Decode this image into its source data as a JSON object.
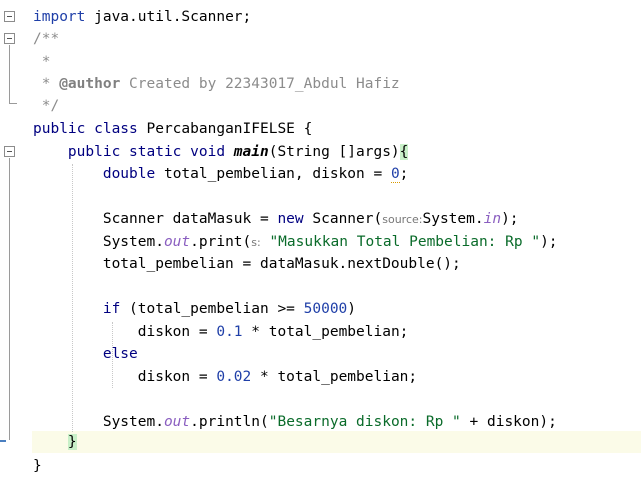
{
  "editor": {
    "lines": {
      "l1": {
        "kw": "import",
        "rest": " java.util.Scanner;"
      },
      "l2": {
        "text": "/**"
      },
      "l3": {
        "text": " *"
      },
      "l4": {
        "prefix": " * ",
        "tag": "@author",
        "rest": " Created by 22343017_Abdul Hafiz"
      },
      "l5": {
        "text": " */"
      },
      "l6": {
        "kw": "public class",
        "rest": " PercabanganIFELSE {"
      },
      "l7": {
        "indent": "    ",
        "kw": "public static void",
        "space": " ",
        "method": "main",
        "rest": "(String []args)",
        "brace": "{"
      },
      "l8": {
        "indent": "        ",
        "kw": "double",
        "rest": " total_pembelian, diskon = ",
        "num": "0",
        "end": ";"
      },
      "l9": {
        "indent": "        ",
        "pre": "Scanner dataMasuk = ",
        "kw": "new",
        "mid": " Scanner(",
        "hint": "source:",
        "post": "System.",
        "field": "in",
        "end": ");"
      },
      "l10": {
        "indent": "        ",
        "pre": "System.",
        "field": "out",
        "mid": ".print(",
        "hint": "s:",
        "space": " ",
        "str": "\"Masukkan Total Pembelian: Rp \"",
        "end": ");"
      },
      "l11": {
        "indent": "        ",
        "text": "total_pembelian = dataMasuk.nextDouble();"
      },
      "l12": {
        "indent": "        ",
        "kw": "if",
        "rest": " (total_pembelian >= ",
        "num": "50000",
        "end": ")"
      },
      "l13": {
        "indent": "            ",
        "pre": "diskon = ",
        "num": "0.1",
        "rest": " * total_pembelian;"
      },
      "l14": {
        "indent": "        ",
        "kw": "else"
      },
      "l15": {
        "indent": "            ",
        "pre": "diskon = ",
        "num": "0.02",
        "rest": " * total_pembelian;"
      },
      "l16": {
        "indent": "        ",
        "pre": "System.",
        "field": "out",
        "mid": ".println(",
        "str": "\"Besarnya diskon: Rp \"",
        "rest": " + diskon);"
      },
      "l17": {
        "indent": "    ",
        "brace": "}"
      },
      "l18": {
        "text": "}"
      }
    }
  }
}
